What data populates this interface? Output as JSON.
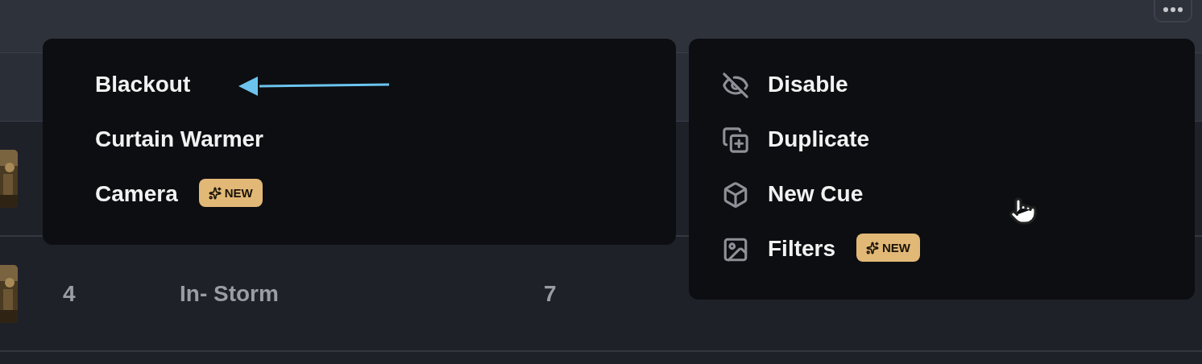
{
  "table": {
    "rows": [
      {
        "thumbnail": {
          "kind": "picture"
        }
      },
      {
        "thumbnail": {
          "kind": "picture"
        },
        "number": "4",
        "name": "In- Storm",
        "column_3": "7"
      }
    ]
  },
  "left_menu": {
    "items": [
      {
        "label": "Blackout"
      },
      {
        "label": "Curtain Warmer"
      },
      {
        "label": "Camera",
        "badge": "NEW"
      }
    ]
  },
  "right_menu": {
    "items": [
      {
        "label": "Disable"
      },
      {
        "label": "Duplicate"
      },
      {
        "label": "New Cue"
      },
      {
        "label": "Filters",
        "badge": "NEW"
      }
    ]
  }
}
